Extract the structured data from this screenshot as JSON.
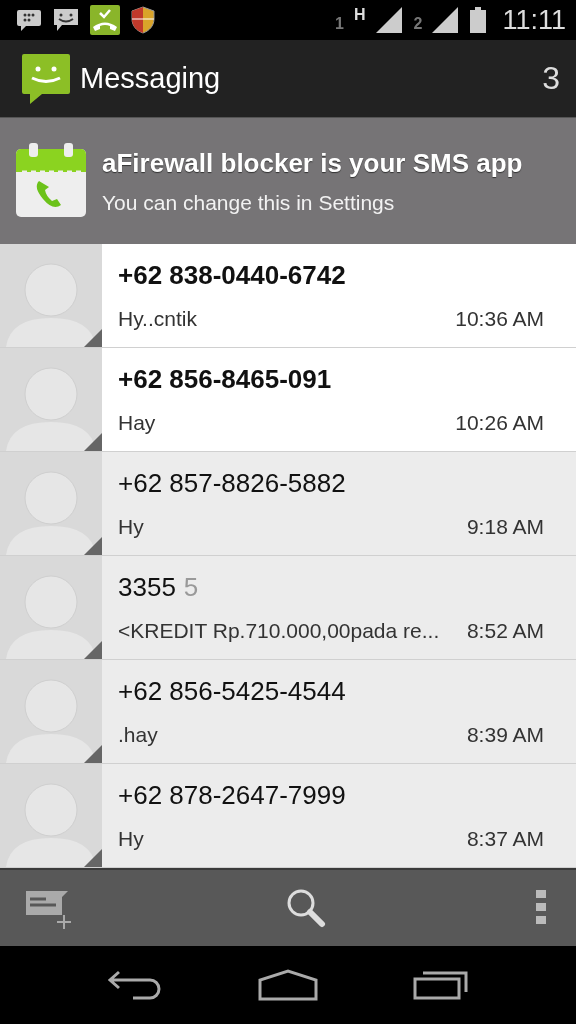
{
  "status_bar": {
    "sim1": "1",
    "network": "H",
    "sim2": "2",
    "time": "11:11"
  },
  "action_bar": {
    "title": "Messaging",
    "count": "3"
  },
  "banner": {
    "title": "aFirewall blocker is your SMS app",
    "subtitle": "You can change this in Settings"
  },
  "conversations": [
    {
      "name": "+62 838-0440-6742",
      "snippet": "Hy..cntik",
      "time": "10:36 AM",
      "unread": true
    },
    {
      "name": "+62 856-8465-091",
      "snippet": "Hay",
      "time": "10:26 AM",
      "unread": true
    },
    {
      "name": "+62 857-8826-5882",
      "snippet": "Hy",
      "time": "9:18 AM",
      "unread": false
    },
    {
      "name": "3355",
      "count": "5",
      "snippet": "<KREDIT Rp.710.000,00pada re...",
      "time": "8:52 AM",
      "unread": false
    },
    {
      "name": "+62 856-5425-4544",
      "snippet": ".hay",
      "time": "8:39 AM",
      "unread": false
    },
    {
      "name": "+62 878-2647-7999",
      "snippet": "Hy",
      "time": "8:37 AM",
      "unread": false
    }
  ]
}
